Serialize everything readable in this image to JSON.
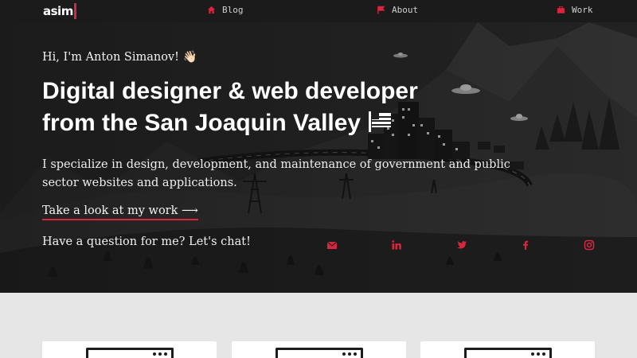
{
  "header": {
    "logo_text": "asim",
    "nav": [
      {
        "label": "Blog",
        "icon": "home-icon"
      },
      {
        "label": "About",
        "icon": "flag-icon"
      },
      {
        "label": "Work",
        "icon": "briefcase-icon"
      }
    ]
  },
  "hero": {
    "greeting": "Hi, I'm Anton Simanov! 👋🏻",
    "headline_line1": "Digital designer & web developer",
    "headline_line2": "from the San Joaquin Valley",
    "intro": "I specialize in design, development, and maintenance of government and public sector websites and applications.",
    "work_link": "Take a look at my work ⟶",
    "chat_text": "Have a question for me? Let's chat!",
    "social": [
      "mail-icon",
      "linkedin-icon",
      "twitter-icon",
      "facebook-icon",
      "instagram-icon"
    ]
  },
  "colors": {
    "accent": "#d7263d",
    "header_bg": "#1b1b1b",
    "hero_bg": "#222222",
    "lower_bg": "#e6e6e6"
  }
}
